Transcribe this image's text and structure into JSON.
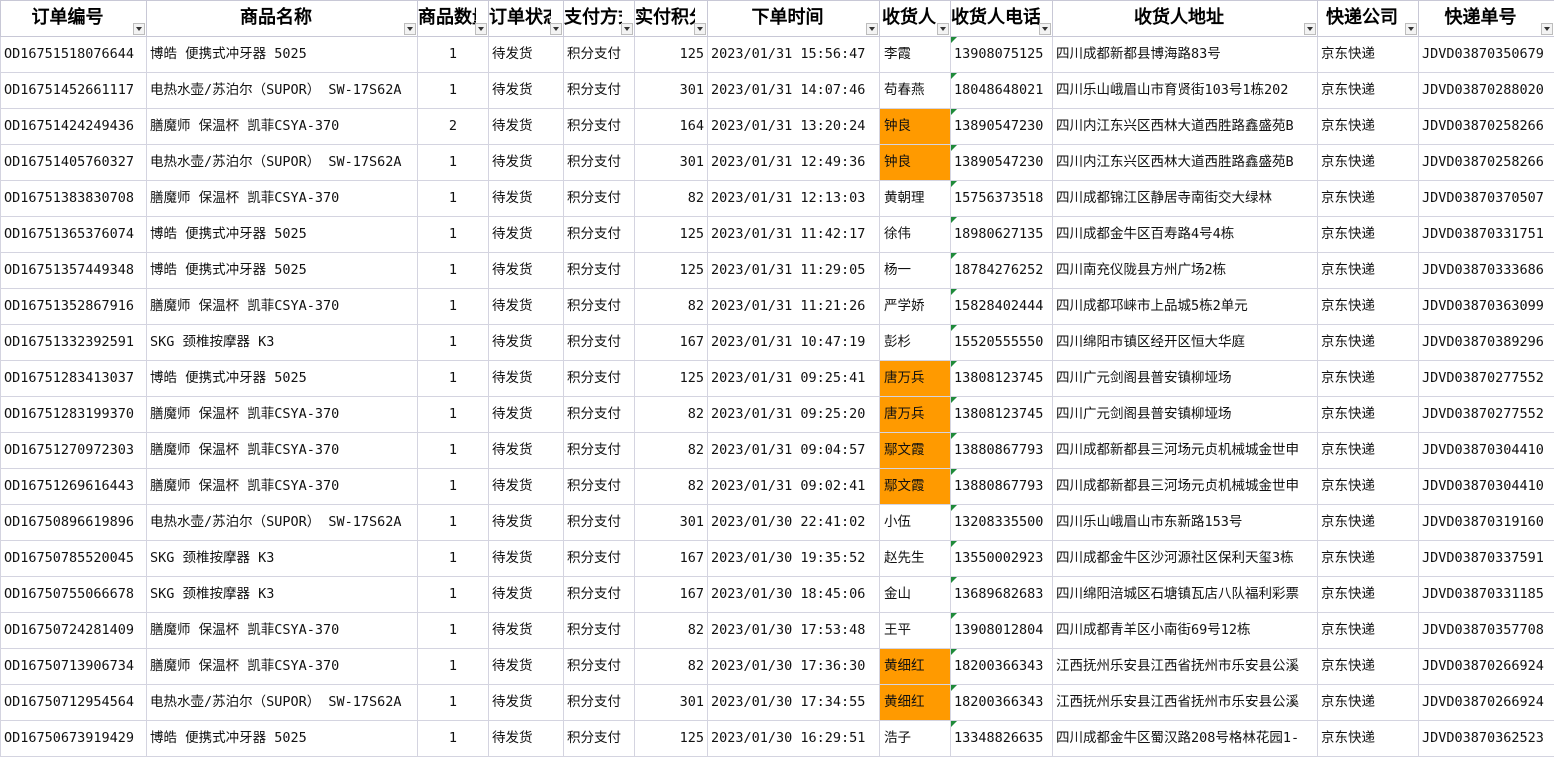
{
  "headers": [
    "订单编号",
    "商品名称",
    "商品数量",
    "订单状态",
    "支付方式",
    "实付积分",
    "下单时间",
    "收货人",
    "收货人电话",
    "收货人地址",
    "快递公司",
    "快递单号"
  ],
  "highlight_color": "#ff9a00",
  "rows": [
    {
      "order_id": "OD16751518076644",
      "product": "博皓 便携式冲牙器 5025",
      "qty": "1",
      "status": "待发货",
      "payment": "积分支付",
      "points": "125",
      "time": "2023/01/31 15:56:47",
      "receiver": "李霞",
      "phone": "13908075125",
      "address": "四川成都新都县博海路83号",
      "courier": "京东快递",
      "tracking": "JDVD03870350679",
      "highlight": false
    },
    {
      "order_id": "OD16751452661117",
      "product": "电热水壶/苏泊尔（SUPOR） SW-17S62A",
      "qty": "1",
      "status": "待发货",
      "payment": "积分支付",
      "points": "301",
      "time": "2023/01/31 14:07:46",
      "receiver": "苟春燕",
      "phone": "18048648021",
      "address": "四川乐山峨眉山市育贤街103号1栋202",
      "courier": "京东快递",
      "tracking": "JDVD03870288020",
      "highlight": false
    },
    {
      "order_id": "OD16751424249436",
      "product": "膳魔师 保温杯 凯菲CSYA-370",
      "qty": "2",
      "status": "待发货",
      "payment": "积分支付",
      "points": "164",
      "time": "2023/01/31 13:20:24",
      "receiver": "钟良",
      "phone": "13890547230",
      "address": "四川内江东兴区西林大道西胜路鑫盛苑B",
      "courier": "京东快递",
      "tracking": "JDVD03870258266",
      "highlight": true
    },
    {
      "order_id": "OD16751405760327",
      "product": "电热水壶/苏泊尔（SUPOR） SW-17S62A",
      "qty": "1",
      "status": "待发货",
      "payment": "积分支付",
      "points": "301",
      "time": "2023/01/31 12:49:36",
      "receiver": "钟良",
      "phone": "13890547230",
      "address": "四川内江东兴区西林大道西胜路鑫盛苑B",
      "courier": "京东快递",
      "tracking": "JDVD03870258266",
      "highlight": true
    },
    {
      "order_id": "OD16751383830708",
      "product": "膳魔师 保温杯 凯菲CSYA-370",
      "qty": "1",
      "status": "待发货",
      "payment": "积分支付",
      "points": "82",
      "time": "2023/01/31 12:13:03",
      "receiver": "黄朝理",
      "phone": "15756373518",
      "address": "四川成都锦江区静居寺南街交大绿林",
      "courier": "京东快递",
      "tracking": "JDVD03870370507",
      "highlight": false
    },
    {
      "order_id": "OD16751365376074",
      "product": "博皓 便携式冲牙器 5025",
      "qty": "1",
      "status": "待发货",
      "payment": "积分支付",
      "points": "125",
      "time": "2023/01/31 11:42:17",
      "receiver": "徐伟",
      "phone": "18980627135",
      "address": "四川成都金牛区百寿路4号4栋",
      "courier": "京东快递",
      "tracking": "JDVD03870331751",
      "highlight": false
    },
    {
      "order_id": "OD16751357449348",
      "product": "博皓 便携式冲牙器 5025",
      "qty": "1",
      "status": "待发货",
      "payment": "积分支付",
      "points": "125",
      "time": "2023/01/31 11:29:05",
      "receiver": "杨一",
      "phone": "18784276252",
      "address": "四川南充仪陇县方州广场2栋",
      "courier": "京东快递",
      "tracking": "JDVD03870333686",
      "highlight": false
    },
    {
      "order_id": "OD16751352867916",
      "product": "膳魔师 保温杯 凯菲CSYA-370",
      "qty": "1",
      "status": "待发货",
      "payment": "积分支付",
      "points": "82",
      "time": "2023/01/31 11:21:26",
      "receiver": "严学娇",
      "phone": "15828402444",
      "address": "四川成都邛崃市上品城5栋2单元",
      "courier": "京东快递",
      "tracking": "JDVD03870363099",
      "highlight": false
    },
    {
      "order_id": "OD16751332392591",
      "product": "SKG 颈椎按摩器 K3",
      "qty": "1",
      "status": "待发货",
      "payment": "积分支付",
      "points": "167",
      "time": "2023/01/31 10:47:19",
      "receiver": "彭杉",
      "phone": "15520555550",
      "address": "四川绵阳市镇区经开区恒大华庭",
      "courier": "京东快递",
      "tracking": "JDVD03870389296",
      "highlight": false
    },
    {
      "order_id": "OD16751283413037",
      "product": "博皓 便携式冲牙器 5025",
      "qty": "1",
      "status": "待发货",
      "payment": "积分支付",
      "points": "125",
      "time": "2023/01/31 09:25:41",
      "receiver": "唐万兵",
      "phone": "13808123745",
      "address": "四川广元剑阁县普安镇柳垭场",
      "courier": "京东快递",
      "tracking": "JDVD03870277552",
      "highlight": true
    },
    {
      "order_id": "OD16751283199370",
      "product": "膳魔师 保温杯 凯菲CSYA-370",
      "qty": "1",
      "status": "待发货",
      "payment": "积分支付",
      "points": "82",
      "time": "2023/01/31 09:25:20",
      "receiver": "唐万兵",
      "phone": "13808123745",
      "address": "四川广元剑阁县普安镇柳垭场",
      "courier": "京东快递",
      "tracking": "JDVD03870277552",
      "highlight": true
    },
    {
      "order_id": "OD16751270972303",
      "product": "膳魔师 保温杯 凯菲CSYA-370",
      "qty": "1",
      "status": "待发货",
      "payment": "积分支付",
      "points": "82",
      "time": "2023/01/31 09:04:57",
      "receiver": "鄢文霞",
      "phone": "13880867793",
      "address": "四川成都新都县三河场元贞机械城金世申",
      "courier": "京东快递",
      "tracking": "JDVD03870304410",
      "highlight": true
    },
    {
      "order_id": "OD16751269616443",
      "product": "膳魔师 保温杯 凯菲CSYA-370",
      "qty": "1",
      "status": "待发货",
      "payment": "积分支付",
      "points": "82",
      "time": "2023/01/31 09:02:41",
      "receiver": "鄢文霞",
      "phone": "13880867793",
      "address": "四川成都新都县三河场元贞机械城金世申",
      "courier": "京东快递",
      "tracking": "JDVD03870304410",
      "highlight": true
    },
    {
      "order_id": "OD16750896619896",
      "product": "电热水壶/苏泊尔（SUPOR） SW-17S62A",
      "qty": "1",
      "status": "待发货",
      "payment": "积分支付",
      "points": "301",
      "time": "2023/01/30 22:41:02",
      "receiver": "小伍",
      "phone": "13208335500",
      "address": "四川乐山峨眉山市东新路153号",
      "courier": "京东快递",
      "tracking": "JDVD03870319160",
      "highlight": false
    },
    {
      "order_id": "OD16750785520045",
      "product": "SKG 颈椎按摩器 K3",
      "qty": "1",
      "status": "待发货",
      "payment": "积分支付",
      "points": "167",
      "time": "2023/01/30 19:35:52",
      "receiver": "赵先生",
      "phone": "13550002923",
      "address": "四川成都金牛区沙河源社区保利天玺3栋",
      "courier": "京东快递",
      "tracking": "JDVD03870337591",
      "highlight": false
    },
    {
      "order_id": "OD16750755066678",
      "product": "SKG 颈椎按摩器 K3",
      "qty": "1",
      "status": "待发货",
      "payment": "积分支付",
      "points": "167",
      "time": "2023/01/30 18:45:06",
      "receiver": "金山",
      "phone": "13689682683",
      "address": "四川绵阳涪城区石塘镇瓦店八队福利彩票",
      "courier": "京东快递",
      "tracking": "JDVD03870331185",
      "highlight": false
    },
    {
      "order_id": "OD16750724281409",
      "product": "膳魔师 保温杯 凯菲CSYA-370",
      "qty": "1",
      "status": "待发货",
      "payment": "积分支付",
      "points": "82",
      "time": "2023/01/30 17:53:48",
      "receiver": "王平",
      "phone": "13908012804",
      "address": "四川成都青羊区小南街69号12栋",
      "courier": "京东快递",
      "tracking": "JDVD03870357708",
      "highlight": false
    },
    {
      "order_id": "OD16750713906734",
      "product": "膳魔师 保温杯 凯菲CSYA-370",
      "qty": "1",
      "status": "待发货",
      "payment": "积分支付",
      "points": "82",
      "time": "2023/01/30 17:36:30",
      "receiver": "黄细红",
      "phone": "18200366343",
      "address": "江西抚州乐安县江西省抚州市乐安县公溪",
      "courier": "京东快递",
      "tracking": "JDVD03870266924",
      "highlight": true
    },
    {
      "order_id": "OD16750712954564",
      "product": "电热水壶/苏泊尔（SUPOR） SW-17S62A",
      "qty": "1",
      "status": "待发货",
      "payment": "积分支付",
      "points": "301",
      "time": "2023/01/30 17:34:55",
      "receiver": "黄细红",
      "phone": "18200366343",
      "address": "江西抚州乐安县江西省抚州市乐安县公溪",
      "courier": "京东快递",
      "tracking": "JDVD03870266924",
      "highlight": true
    },
    {
      "order_id": "OD16750673919429",
      "product": "博皓 便携式冲牙器 5025",
      "qty": "1",
      "status": "待发货",
      "payment": "积分支付",
      "points": "125",
      "time": "2023/01/30 16:29:51",
      "receiver": "浩子",
      "phone": "13348826635",
      "address": "四川成都金牛区蜀汉路208号格林花园1-",
      "courier": "京东快递",
      "tracking": "JDVD03870362523",
      "highlight": false
    }
  ]
}
